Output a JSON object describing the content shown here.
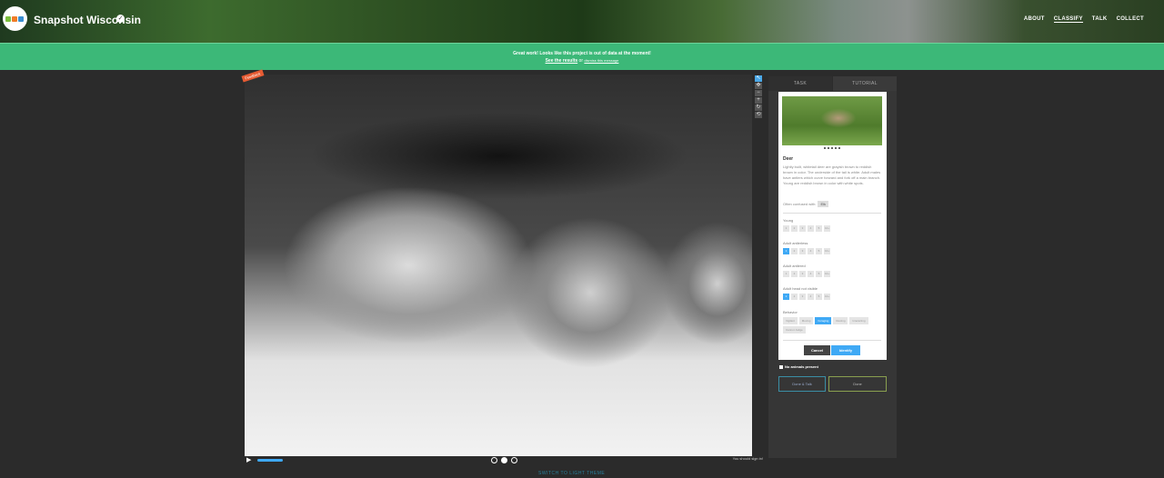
{
  "header": {
    "title": "Snapshot Wisconsin",
    "nav": [
      "ABOUT",
      "CLASSIFY",
      "TALK",
      "COLLECT"
    ]
  },
  "banner": {
    "line1": "Great work! Looks like this project is out of data at the moment!",
    "link": "See the results",
    "or": " or ",
    "dismiss": "dismiss this message"
  },
  "viewer": {
    "badge": "Feedback"
  },
  "task": {
    "tabs": [
      "TASK",
      "TUTORIAL"
    ],
    "species": "Deer",
    "description": "Lightly built, whitetail deer are grayish brown to reddish brown in color. The underside of the tail is white. Adult males have antlers which curve forward and fork off a main branch. Young are reddish brown in color with white spots.",
    "confused_label": "Often confused with:",
    "confused_with": "Elk",
    "questions": [
      {
        "label": "Young",
        "options": [
          "1",
          "2",
          "3",
          "4",
          "5",
          "10+"
        ],
        "selected": -1
      },
      {
        "label": "Adult antlerless",
        "options": [
          "1",
          "2",
          "3",
          "4",
          "5",
          "10+"
        ],
        "selected": 0
      },
      {
        "label": "Adult antlered",
        "options": [
          "1",
          "2",
          "3",
          "4",
          "5",
          "10+"
        ],
        "selected": -1
      },
      {
        "label": "Adult head not visible",
        "options": [
          "1",
          "2",
          "3",
          "4",
          "5",
          "10+"
        ],
        "selected": 0
      }
    ],
    "behavior_label": "Behavior",
    "behaviors": [
      "Vigilant",
      "Moving",
      "Foraging",
      "Resting",
      "Interacting",
      "Cannot Judge"
    ],
    "behavior_selected": 2,
    "cancel": "Cancel",
    "identify": "Identify"
  },
  "bottom": {
    "no_animals": "No animals present",
    "done_talk": "Done & Talk",
    "done": "Done",
    "signin": "You should sign in!",
    "theme": "SWITCH TO LIGHT THEME"
  },
  "colors": {
    "banner": "#3cb878",
    "accent": "#3fa9f5",
    "badge": "#e75b33"
  }
}
